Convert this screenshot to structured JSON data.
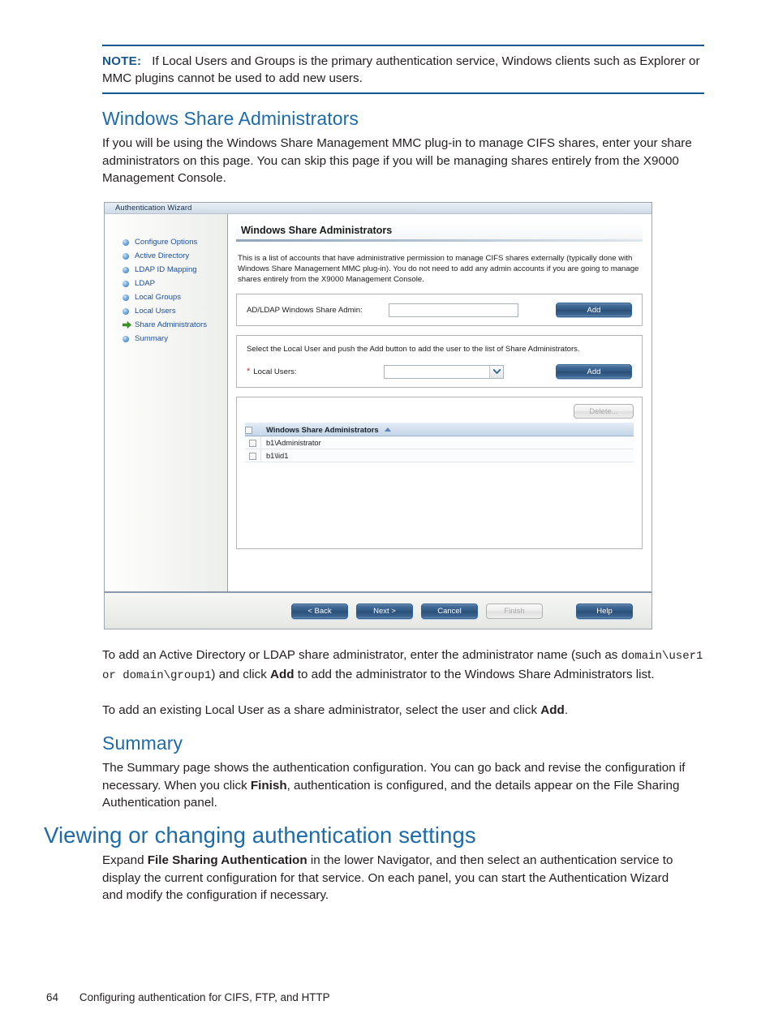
{
  "note": {
    "label": "NOTE:",
    "text": "If Local Users and Groups is the primary authentication service, Windows clients such as Explorer or MMC plugins cannot be used to add new users."
  },
  "sections": {
    "share_admins_heading": "Windows Share Administrators",
    "share_admins_intro": "If you will be using the Windows Share Management MMC plug-in to manage CIFS shares, enter your share administrators on this page. You can skip this page if you will be managing shares entirely from the X9000 Management Console.",
    "after_figure_1_a": "To add an Active Directory or LDAP share administrator, enter the administrator name (such as ",
    "after_figure_1_mono": "domain\\user1 or domain\\group1",
    "after_figure_1_b": ") and click ",
    "after_figure_1_bold": "Add",
    "after_figure_1_c": " to add the administrator to the Windows Share Administrators list.",
    "after_figure_2_a": "To add an existing Local User as a share administrator, select the user and click ",
    "after_figure_2_bold": "Add",
    "after_figure_2_b": ".",
    "summary_heading": "Summary",
    "summary_a": "The Summary page shows the authentication configuration. You can go back and revise the configuration if necessary. When you click ",
    "summary_bold": "Finish",
    "summary_b": ", authentication is configured, and the details appear on the File Sharing Authentication panel.",
    "viewing_heading": "Viewing or changing authentication settings",
    "viewing_a": "Expand ",
    "viewing_bold": "File Sharing Authentication",
    "viewing_b": " in the lower Navigator, and then select an authentication service to display the current configuration for that service. On each panel, you can start the Authentication Wizard and modify the configuration if necessary."
  },
  "dialog": {
    "title": "Authentication Wizard",
    "nav": [
      {
        "label": "Configure Options",
        "icon": "bullet-icon",
        "current": false
      },
      {
        "label": "Active Directory",
        "icon": "bullet-icon",
        "current": false
      },
      {
        "label": "LDAP ID Mapping",
        "icon": "bullet-icon",
        "current": false
      },
      {
        "label": "LDAP",
        "icon": "bullet-icon",
        "current": false
      },
      {
        "label": "Local Groups",
        "icon": "bullet-icon",
        "current": false
      },
      {
        "label": "Local Users",
        "icon": "bullet-icon",
        "current": false
      },
      {
        "label": "Share Administrators",
        "icon": "green-arrow-icon",
        "current": true
      },
      {
        "label": "Summary",
        "icon": "bullet-icon",
        "current": false
      }
    ],
    "panel_title": "Windows Share Administrators",
    "panel_description": "This is a list of accounts that have administrative permission to manage CIFS shares externally (typically done with Windows Share Management MMC plug-in). You do not need to add any admin accounts if you are going to manage shares entirely from the X9000 Management Console.",
    "ad_row": {
      "label": "AD/LDAP Windows Share Admin:",
      "value": "",
      "add_label": "Add"
    },
    "local_row": {
      "hint": "Select the Local User and push the Add button to add the user to the list of Share Administrators.",
      "label": "Local Users:",
      "required_mark": "*",
      "value": "",
      "add_label": "Add"
    },
    "list": {
      "delete_label": "Delete...",
      "column_header": "Windows Share Administrators",
      "sort_direction": "ascending",
      "rows": [
        {
          "name": "b1\\Administrator",
          "checked": false
        },
        {
          "name": "b1\\lid1",
          "checked": false
        }
      ]
    },
    "buttons": {
      "back": "< Back",
      "next": "Next >",
      "cancel": "Cancel",
      "finish": "Finish",
      "help": "Help"
    }
  },
  "page_footer": {
    "number": "64",
    "text": "Configuring authentication for CIFS, FTP, and HTTP"
  }
}
